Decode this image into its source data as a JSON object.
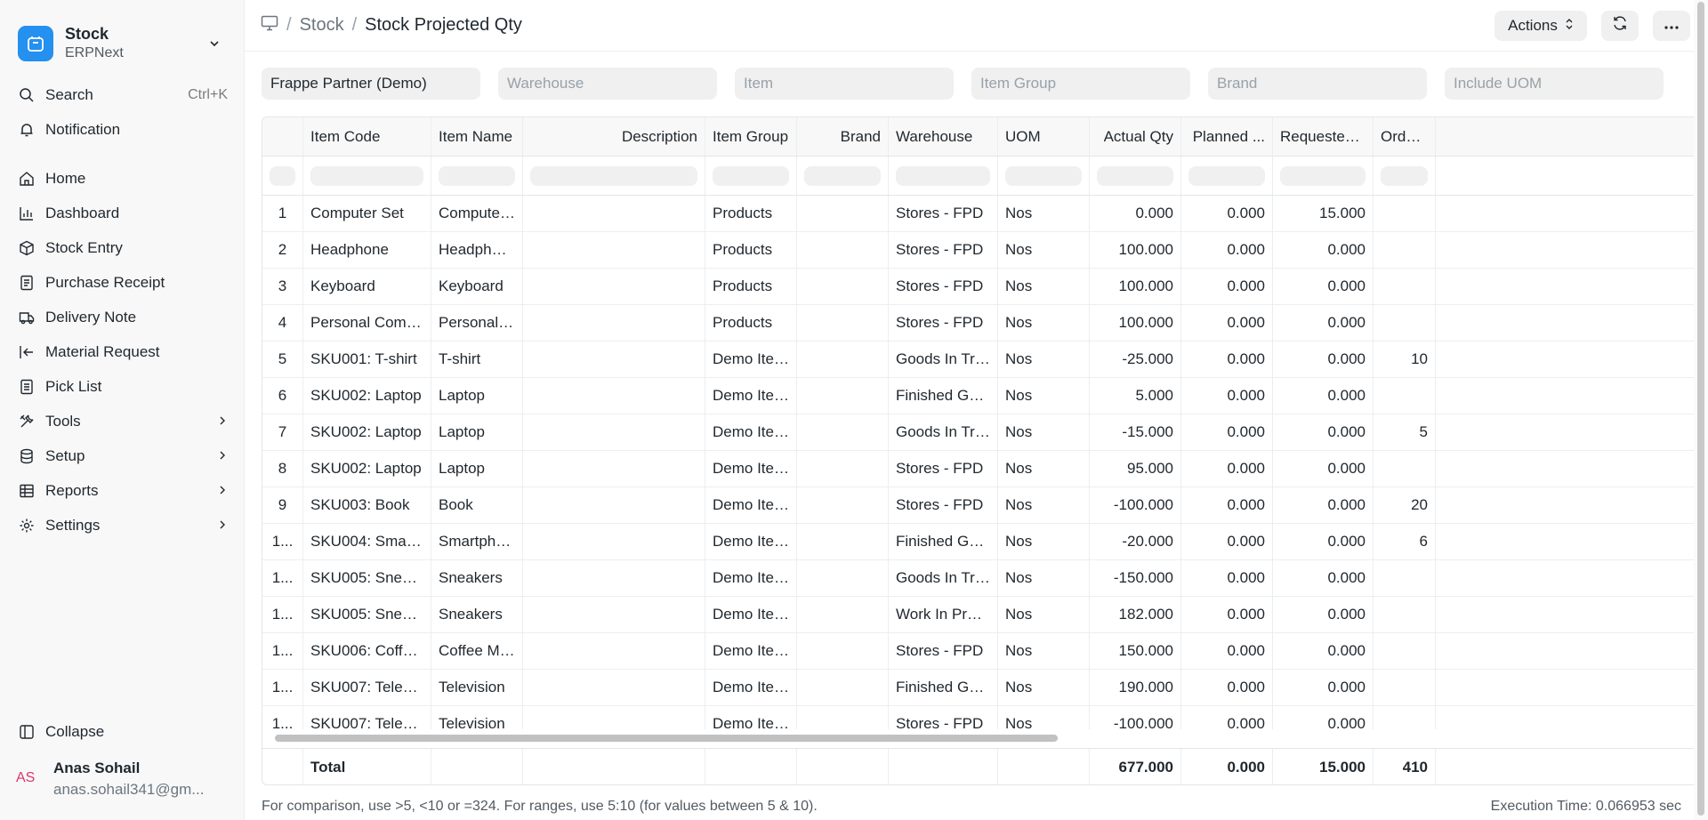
{
  "workspace": {
    "title": "Stock",
    "subtitle": "ERPNext"
  },
  "sidebar": {
    "search": {
      "label": "Search",
      "shortcut": "Ctrl+K"
    },
    "notification": {
      "label": "Notification"
    },
    "items": [
      {
        "label": "Home",
        "icon": "home-icon"
      },
      {
        "label": "Dashboard",
        "icon": "bar-chart-icon"
      },
      {
        "label": "Stock Entry",
        "icon": "box-icon"
      },
      {
        "label": "Purchase Receipt",
        "icon": "receipt-icon"
      },
      {
        "label": "Delivery Note",
        "icon": "truck-icon"
      },
      {
        "label": "Material Request",
        "icon": "arrow-in-icon"
      },
      {
        "label": "Pick List",
        "icon": "list-icon"
      },
      {
        "label": "Tools",
        "icon": "tools-icon"
      },
      {
        "label": "Setup",
        "icon": "database-icon"
      },
      {
        "label": "Reports",
        "icon": "table-icon"
      },
      {
        "label": "Settings",
        "icon": "gear-icon"
      }
    ],
    "collapse": "Collapse",
    "user": {
      "initials": "AS",
      "name": "Anas Sohail",
      "email": "anas.sohail341@gm..."
    }
  },
  "breadcrumb": {
    "parent": "Stock",
    "current": "Stock Projected Qty"
  },
  "toolbar": {
    "actions": "Actions"
  },
  "filters": [
    {
      "value": "Frappe Partner (Demo)",
      "placeholder": ""
    },
    {
      "value": "",
      "placeholder": "Warehouse"
    },
    {
      "value": "",
      "placeholder": "Item"
    },
    {
      "value": "",
      "placeholder": "Item Group"
    },
    {
      "value": "",
      "placeholder": "Brand"
    },
    {
      "value": "",
      "placeholder": "Include UOM"
    }
  ],
  "table": {
    "columns": [
      "Item Code",
      "Item Name",
      "Description",
      "Item Group",
      "Brand",
      "Warehouse",
      "UOM",
      "Actual Qty",
      "Planned ...",
      "Requested ...",
      "Ordered"
    ],
    "rows": [
      {
        "idx": "1",
        "cells": [
          "Computer Set",
          "Computer ...",
          "",
          "Products",
          "",
          "Stores - FPD",
          "Nos",
          "0.000",
          "0.000",
          "15.000",
          ""
        ]
      },
      {
        "idx": "2",
        "cells": [
          "Headphone",
          "Headphone",
          "",
          "Products",
          "",
          "Stores - FPD",
          "Nos",
          "100.000",
          "0.000",
          "0.000",
          ""
        ]
      },
      {
        "idx": "3",
        "cells": [
          "Keyboard",
          "Keyboard",
          "",
          "Products",
          "",
          "Stores - FPD",
          "Nos",
          "100.000",
          "0.000",
          "0.000",
          ""
        ]
      },
      {
        "idx": "4",
        "cells": [
          "Personal Comput...",
          "Personal C...",
          "",
          "Products",
          "",
          "Stores - FPD",
          "Nos",
          "100.000",
          "0.000",
          "0.000",
          ""
        ]
      },
      {
        "idx": "5",
        "cells": [
          "SKU001: T-shirt",
          "T-shirt",
          "",
          "Demo Item ...",
          "",
          "Goods In Tran...",
          "Nos",
          "-25.000",
          "0.000",
          "0.000",
          "10"
        ]
      },
      {
        "idx": "6",
        "cells": [
          "SKU002: Laptop",
          "Laptop",
          "",
          "Demo Item ...",
          "",
          "Finished Good...",
          "Nos",
          "5.000",
          "0.000",
          "0.000",
          ""
        ]
      },
      {
        "idx": "7",
        "cells": [
          "SKU002: Laptop",
          "Laptop",
          "",
          "Demo Item ...",
          "",
          "Goods In Tran...",
          "Nos",
          "-15.000",
          "0.000",
          "0.000",
          "5"
        ]
      },
      {
        "idx": "8",
        "cells": [
          "SKU002: Laptop",
          "Laptop",
          "",
          "Demo Item ...",
          "",
          "Stores - FPD",
          "Nos",
          "95.000",
          "0.000",
          "0.000",
          ""
        ]
      },
      {
        "idx": "9",
        "cells": [
          "SKU003: Book",
          "Book",
          "",
          "Demo Item ...",
          "",
          "Stores - FPD",
          "Nos",
          "-100.000",
          "0.000",
          "0.000",
          "20"
        ]
      },
      {
        "idx": "1...",
        "cells": [
          "SKU004: Smartp...",
          "Smartphone",
          "",
          "Demo Item ...",
          "",
          "Finished Good...",
          "Nos",
          "-20.000",
          "0.000",
          "0.000",
          "6"
        ]
      },
      {
        "idx": "1...",
        "cells": [
          "SKU005: Sneakers",
          "Sneakers",
          "",
          "Demo Item ...",
          "",
          "Goods In Tran...",
          "Nos",
          "-150.000",
          "0.000",
          "0.000",
          ""
        ]
      },
      {
        "idx": "1...",
        "cells": [
          "SKU005: Sneakers",
          "Sneakers",
          "",
          "Demo Item ...",
          "",
          "Work In Progr...",
          "Nos",
          "182.000",
          "0.000",
          "0.000",
          ""
        ]
      },
      {
        "idx": "1...",
        "cells": [
          "SKU006: Coffee ...",
          "Coffee Mug",
          "",
          "Demo Item ...",
          "",
          "Stores - FPD",
          "Nos",
          "150.000",
          "0.000",
          "0.000",
          ""
        ]
      },
      {
        "idx": "1...",
        "cells": [
          "SKU007: Televisi...",
          "Television",
          "",
          "Demo Item ...",
          "",
          "Finished Good...",
          "Nos",
          "190.000",
          "0.000",
          "0.000",
          ""
        ]
      },
      {
        "idx": "1...",
        "cells": [
          "SKU007: Televisi...",
          "Television",
          "",
          "Demo Item ...",
          "",
          "Stores - FPD",
          "Nos",
          "-100.000",
          "0.000",
          "0.000",
          ""
        ]
      }
    ],
    "total": {
      "label": "Total",
      "actual_qty": "677.000",
      "planned": "0.000",
      "requested": "15.000",
      "ordered": "410"
    }
  },
  "footer": {
    "hint": "For comparison, use >5, <10 or =324. For ranges, use 5:10 (for values between 5 & 10).",
    "execution_time": "Execution Time: 0.066953 sec"
  },
  "colors": {
    "brand": "#2490ef",
    "avatar_text": "#d9376e"
  }
}
